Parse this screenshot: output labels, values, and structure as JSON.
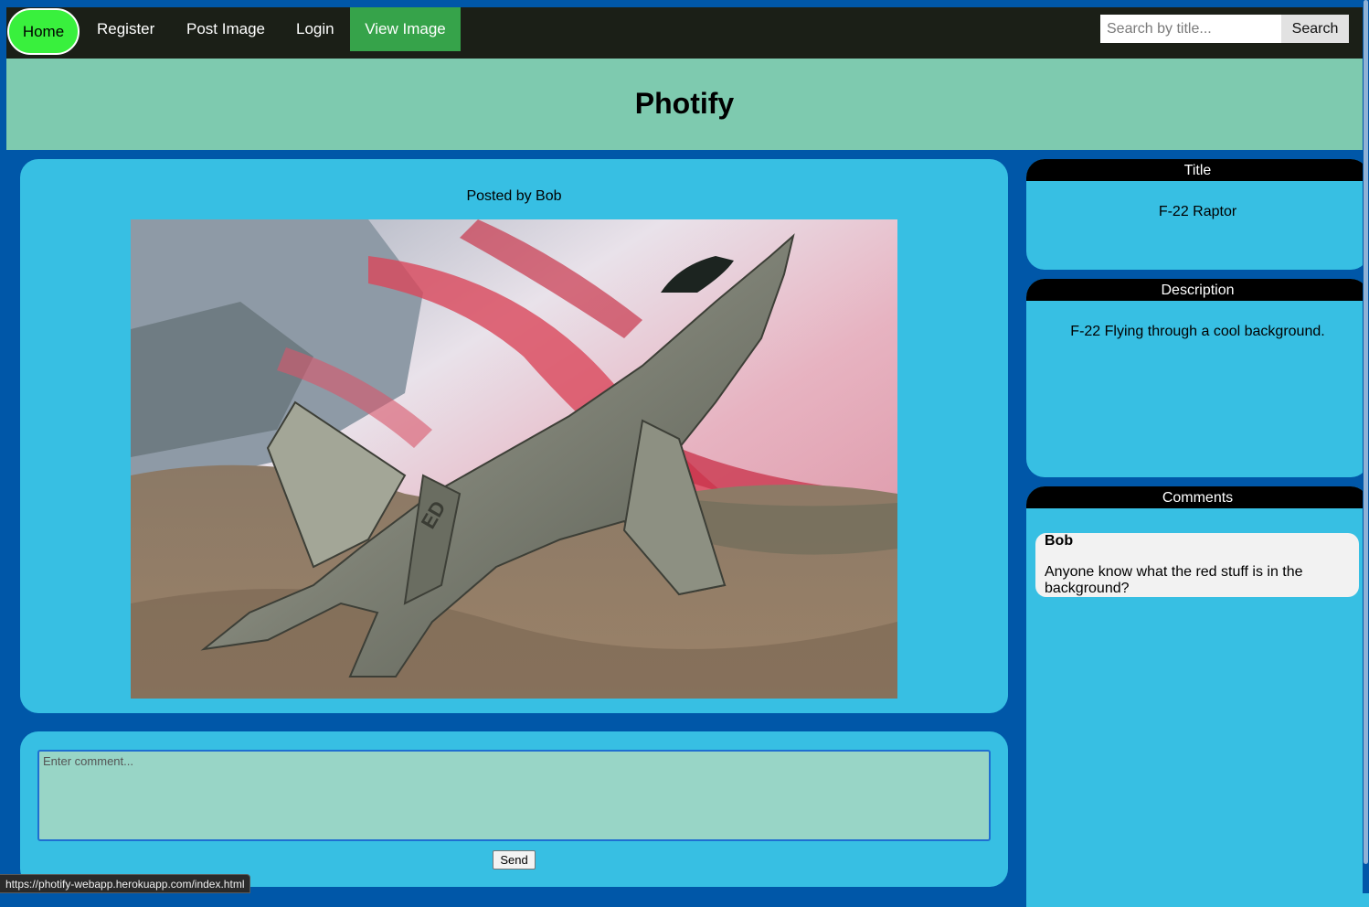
{
  "nav": {
    "home": "Home",
    "register": "Register",
    "post_image": "Post Image",
    "login": "Login",
    "view_image": "View Image",
    "search_placeholder": "Search by title...",
    "search_button": "Search"
  },
  "header": {
    "title": "Photify"
  },
  "post": {
    "posted_by": "Posted by Bob",
    "image_alt": "F-22 Raptor jet flying over red and white terrain"
  },
  "comment_form": {
    "placeholder": "Enter comment...",
    "value": "",
    "send": "Send"
  },
  "sidebar": {
    "title_heading": "Title",
    "title_value": "F-22 Raptor",
    "description_heading": "Description",
    "description_value": "F-22 Flying through a cool background.",
    "comments_heading": "Comments",
    "comments": [
      {
        "author": "Bob",
        "text": "Anyone know what the red stuff is in the background?"
      }
    ]
  },
  "status_bar": {
    "url": "https://photify-webapp.herokuapp.com/index.html"
  },
  "colors": {
    "page_bg": "#0057a8",
    "nav_bg": "#1b1f17",
    "home_active": "#39f03d",
    "view_active": "#36a34a",
    "header_bg": "#7ecaaf",
    "card_bg": "#37bfe3",
    "textarea_bg": "#98d5c6"
  }
}
